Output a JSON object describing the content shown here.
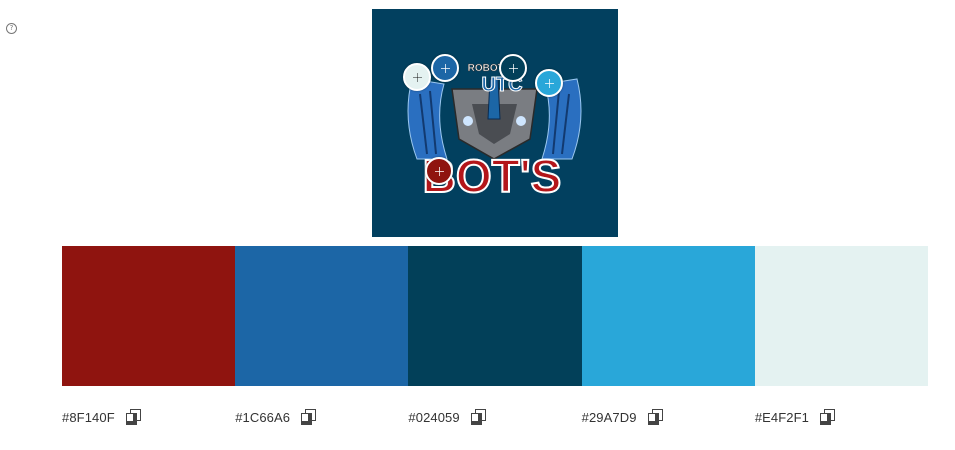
{
  "help": {
    "icon": "question-circle-icon",
    "glyph": "?"
  },
  "image": {
    "background": "#02405F",
    "logo_top_text": "ROBOTICS",
    "logo_mid_text": "UTC",
    "logo_bottom_text": "BOT'S"
  },
  "palette": [
    {
      "hex": "#8F140F",
      "color": "#8F140F"
    },
    {
      "hex": "#1C66A6",
      "color": "#1C66A6"
    },
    {
      "hex": "#024059",
      "color": "#024059"
    },
    {
      "hex": "#29A7D9",
      "color": "#29A7D9"
    },
    {
      "hex": "#E4F2F1",
      "color": "#E4F2F1"
    }
  ],
  "copy_icon": "copy-icon"
}
